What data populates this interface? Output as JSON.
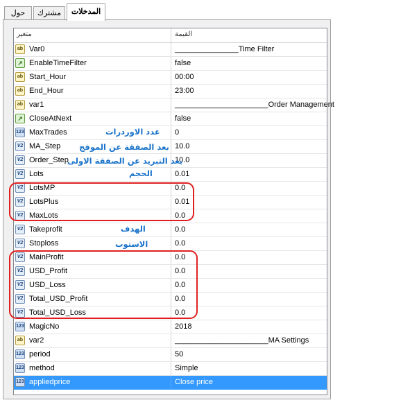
{
  "tabs": [
    {
      "label": "حول",
      "active": false
    },
    {
      "label": "مشترك",
      "active": false
    },
    {
      "label": "المدخلات",
      "active": true
    }
  ],
  "table": {
    "header_variable": "متغير",
    "header_value": "القيمة"
  },
  "params": [
    {
      "icon": "ab",
      "type": "string",
      "name": "Var0",
      "value": "_______________Time Filter"
    },
    {
      "icon": "bool",
      "type": "bool",
      "name": "EnableTimeFilter",
      "value": "false"
    },
    {
      "icon": "ab",
      "type": "string",
      "name": "Start_Hour",
      "value": "00:00"
    },
    {
      "icon": "ab",
      "type": "string",
      "name": "End_Hour",
      "value": "23:00"
    },
    {
      "icon": "ab",
      "type": "string",
      "name": "var1",
      "value": "______________________Order Management"
    },
    {
      "icon": "bool",
      "type": "bool",
      "name": "CloseAtNext",
      "value": "false"
    },
    {
      "icon": "123",
      "type": "int",
      "name": "MaxTrades",
      "value": "0"
    },
    {
      "icon": "v2",
      "type": "double",
      "name": "MA_Step",
      "value": "10.0"
    },
    {
      "icon": "v2",
      "type": "double",
      "name": "Order_Step",
      "value": "10.0"
    },
    {
      "icon": "v2",
      "type": "double",
      "name": "Lots",
      "value": "0.01"
    },
    {
      "icon": "v2",
      "type": "double",
      "name": "LotsMP",
      "value": "0.0"
    },
    {
      "icon": "v2",
      "type": "double",
      "name": "LotsPlus",
      "value": "0.01"
    },
    {
      "icon": "v2",
      "type": "double",
      "name": "MaxLots",
      "value": "0.0"
    },
    {
      "icon": "v2",
      "type": "double",
      "name": "Takeprofit",
      "value": "0.0"
    },
    {
      "icon": "v2",
      "type": "double",
      "name": "Stoploss",
      "value": "0.0"
    },
    {
      "icon": "v2",
      "type": "double",
      "name": "MainProfit",
      "value": "0.0"
    },
    {
      "icon": "v2",
      "type": "double",
      "name": "USD_Profit",
      "value": "0.0"
    },
    {
      "icon": "v2",
      "type": "double",
      "name": "USD_Loss",
      "value": "0.0"
    },
    {
      "icon": "v2",
      "type": "double",
      "name": "Total_USD_Profit",
      "value": "0.0"
    },
    {
      "icon": "v2",
      "type": "double",
      "name": "Total_USD_Loss",
      "value": "0.0"
    },
    {
      "icon": "123",
      "type": "int",
      "name": "MagicNo",
      "value": "2018"
    },
    {
      "icon": "ab",
      "type": "string",
      "name": "var2",
      "value": "______________________MA Settings"
    },
    {
      "icon": "123",
      "type": "int",
      "name": "period",
      "value": "50"
    },
    {
      "icon": "123",
      "type": "int",
      "name": "method",
      "value": "Simple"
    },
    {
      "icon": "123",
      "type": "int",
      "name": "appliedprice",
      "value": "Close price",
      "selected": true
    }
  ],
  "annotations": {
    "max_trades": "عدد الاوردرات",
    "ma_step": "بعد الصفقة عن الموفج",
    "order_step": "بعد التبريد عن الصفقة الاولى",
    "lots": "الحجم",
    "takeprofit": "الهدف",
    "stoploss": "الاستوب"
  },
  "colors": {
    "selection": "#3399ff",
    "highlight_box": "#e02020",
    "annotation_text": "#1a73c9"
  }
}
